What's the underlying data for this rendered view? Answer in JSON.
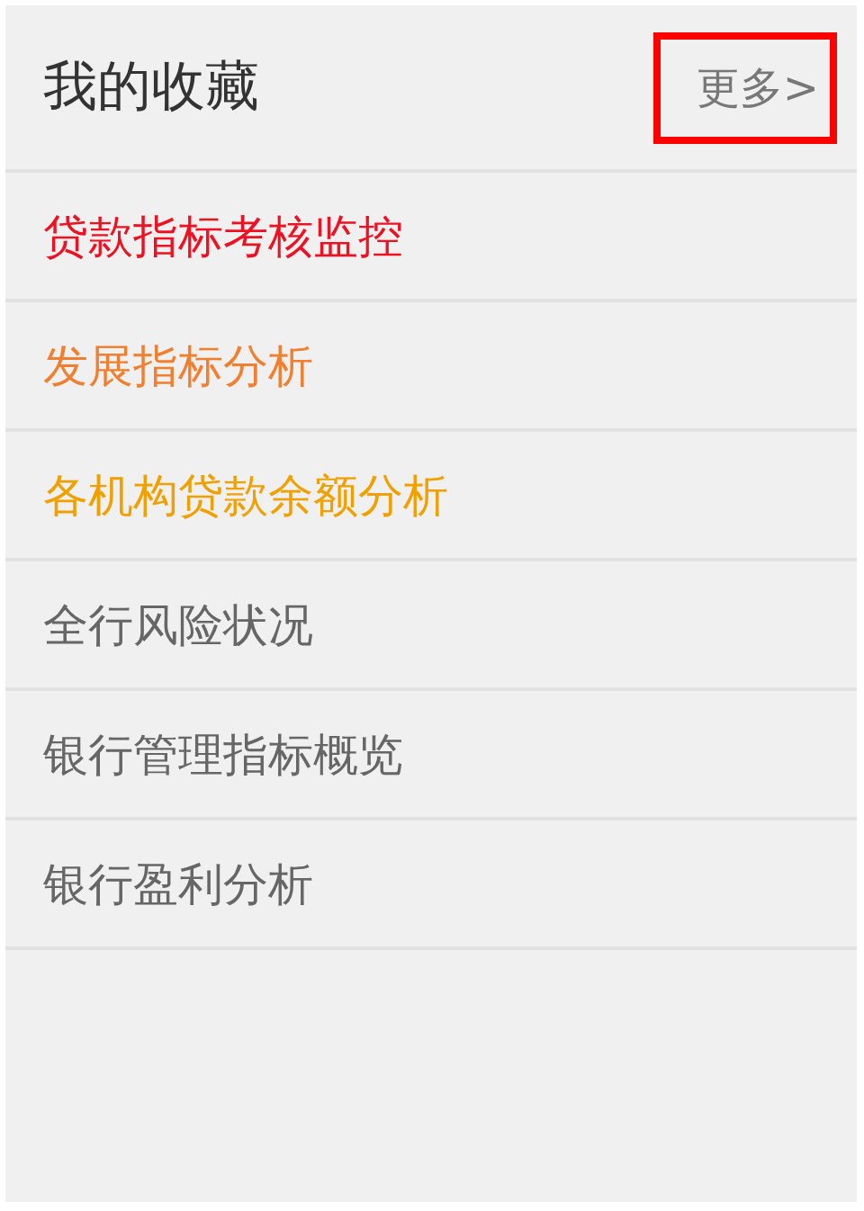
{
  "header": {
    "title": "我的收藏",
    "more": {
      "label": "更多>",
      "highlighted": true
    }
  },
  "favorites": [
    {
      "label": "贷款指标考核监控",
      "color": "#ee1122"
    },
    {
      "label": "发展指标分析",
      "color": "#f08030"
    },
    {
      "label": "各机构贷款余额分析",
      "color": "#f0a000"
    },
    {
      "label": "全行风险状况",
      "color": "#666666"
    },
    {
      "label": "银行管理指标概览",
      "color": "#666666"
    },
    {
      "label": "银行盈利分析",
      "color": "#666666"
    }
  ]
}
